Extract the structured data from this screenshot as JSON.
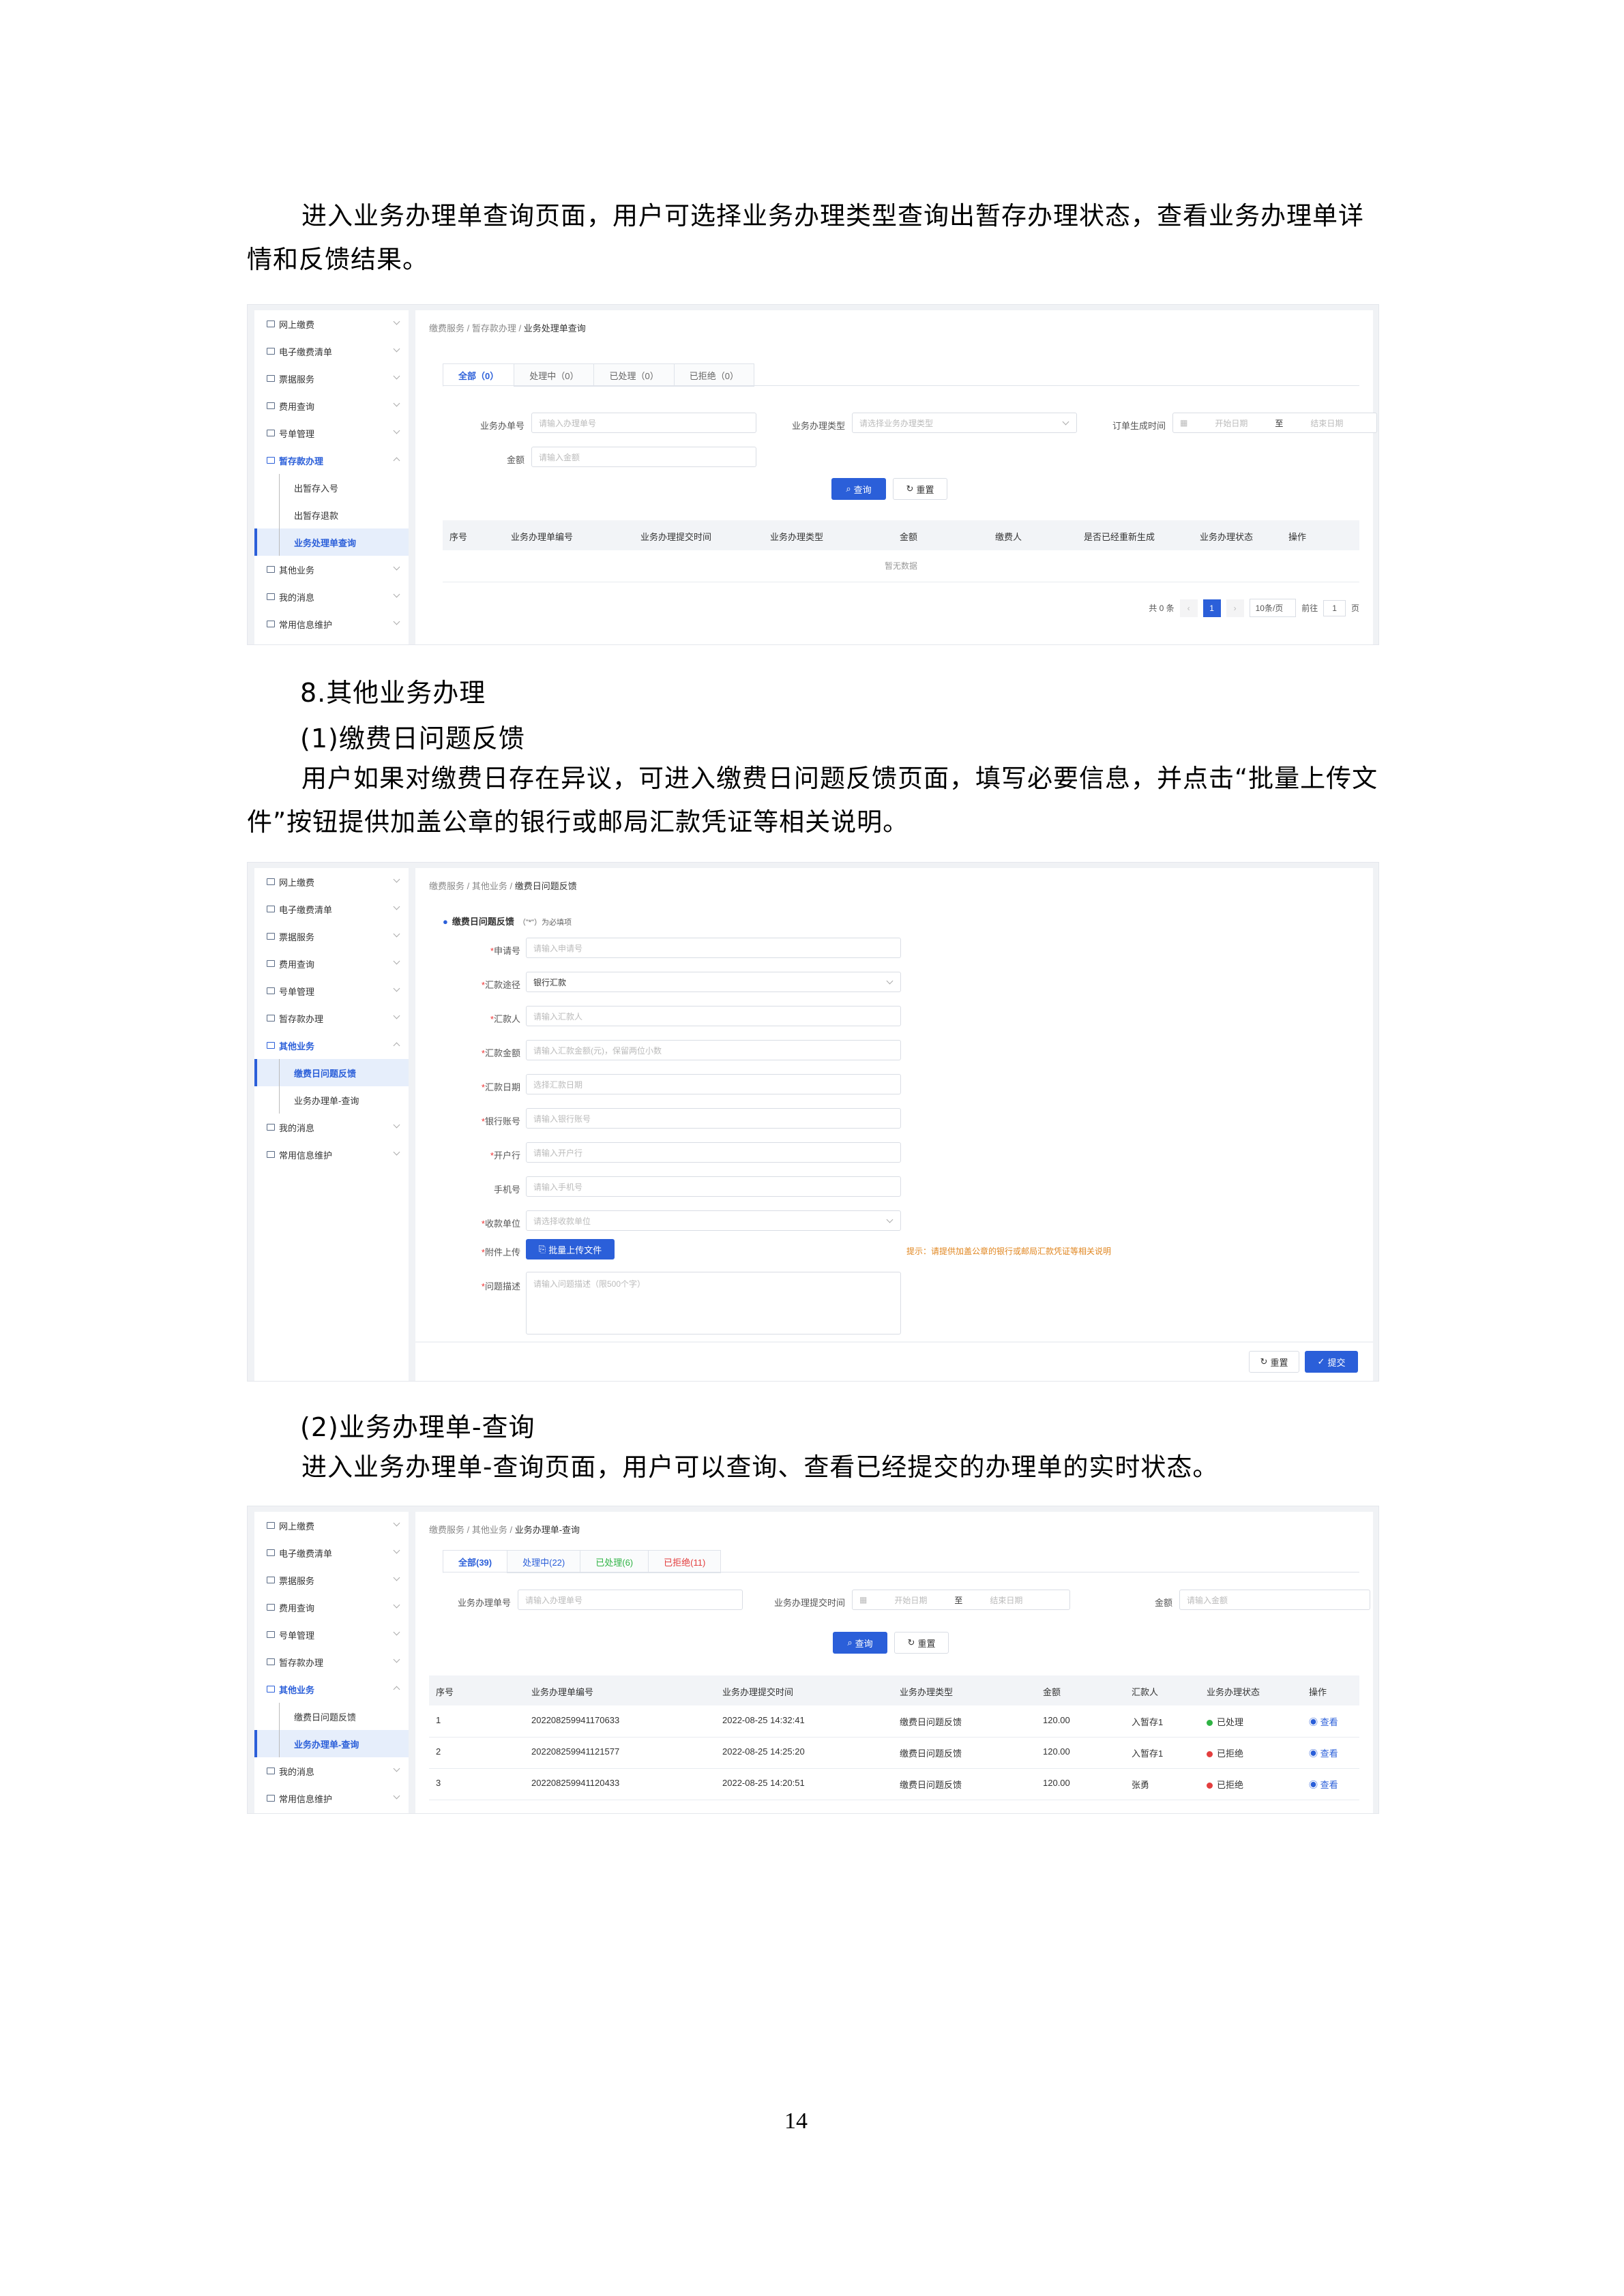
{
  "intro": {
    "para1": "进入业务办理单查询页面，用户可选择业务办理类型查询出暂存办理状态，查看业务办理单详情和反馈结果。"
  },
  "section8": {
    "title": "8.其他业务办理",
    "sub1": "(1)缴费日问题反馈",
    "para1": "用户如果对缴费日存在异议，可进入缴费日问题反馈页面，填写必要信息，并点击“批量上传文件”按钮提供加盖公章的银行或邮局汇款凭证等相关说明。",
    "sub2": "(2)业务办理单-查询",
    "para2": "进入业务办理单-查询页面，用户可以查询、查看已经提交的办理单的实时状态。"
  },
  "sidebar_common": {
    "online_pay": "网上缴费",
    "e_bill": "电子缴费清单",
    "invoice": "票据服务",
    "fee_query": "费用查询",
    "account_mgmt": "号单管理",
    "temp_pay": "暂存款办理",
    "other_biz": "其他业务",
    "my_msg": "我的消息",
    "common_info": "常用信息维护"
  },
  "shot1": {
    "breadcrumb": [
      "缴费服务",
      "暂存款办理",
      "业务处理单查询"
    ],
    "sub_items": [
      "出暂存入号",
      "出暂存退款",
      "业务处理单查询"
    ],
    "tabs": [
      "全部（0）",
      "处理中（0）",
      "已处理（0）",
      "已拒绝（0）"
    ],
    "labels": {
      "order_no": "业务办单号",
      "type": "业务办理类型",
      "gen_time": "订单生成时间",
      "amount": "金额",
      "to": "至"
    },
    "placeholders": {
      "order_no": "请输入办理单号",
      "type": "请选择业务办理类型",
      "start": "开始日期",
      "end": "结束日期",
      "amount": "请输入金额"
    },
    "buttons": {
      "query": "查询",
      "reset": "重置"
    },
    "columns": [
      "序号",
      "业务办理单编号",
      "业务办理提交时间",
      "业务办理类型",
      "金额",
      "缴费人",
      "是否已经重新生成",
      "业务办理状态",
      "操作"
    ],
    "empty": "暂无数据",
    "pager": {
      "total": "共 0 条",
      "page": "1",
      "size": "10条/页",
      "goto": "前往",
      "goto_val": "1",
      "unit": "页"
    }
  },
  "shot2": {
    "breadcrumb": [
      "缴费服务",
      "其他业务",
      "缴费日问题反馈"
    ],
    "sub_items": [
      "缴费日问题反馈",
      "业务办理单-查询"
    ],
    "section_title": "缴费日问题反馈",
    "section_note": "（\"*\"）为必填项",
    "fields": [
      {
        "label": "申请号",
        "req": "*",
        "ph": "请输入申请号",
        "select": false,
        "filled": false
      },
      {
        "label": "汇款途径",
        "req": "*",
        "ph": "银行汇款",
        "select": true,
        "filled": true
      },
      {
        "label": "汇款人",
        "req": "*",
        "ph": "请输入汇款人",
        "select": false,
        "filled": false
      },
      {
        "label": "汇款金额",
        "req": "*",
        "ph": "请输入汇款金额(元)，保留两位小数",
        "select": false,
        "filled": false
      },
      {
        "label": "汇款日期",
        "req": "*",
        "ph": "选择汇款日期",
        "select": false,
        "filled": false
      },
      {
        "label": "银行账号",
        "req": "*",
        "ph": "请输入银行账号",
        "select": false,
        "filled": false
      },
      {
        "label": "开户行",
        "req": "*",
        "ph": "请输入开户行",
        "select": false,
        "filled": false
      },
      {
        "label": "手机号",
        "req": "",
        "ph": "请输入手机号",
        "select": false,
        "filled": false
      },
      {
        "label": "收款单位",
        "req": "*",
        "ph": "请选择收款单位",
        "select": true,
        "filled": false
      }
    ],
    "upload_label": "附件上传",
    "upload_btn": "批量上传文件",
    "upload_tip": "提示：请提供加盖公章的银行或邮局汇款凭证等相关说明",
    "desc_label": "问题描述",
    "desc_ph": "请输入问题描述（限500个字）",
    "reset": "重置",
    "submit": "提交"
  },
  "shot3": {
    "breadcrumb": [
      "缴费服务",
      "其他业务",
      "业务办理单-查询"
    ],
    "sub_items": [
      "缴费日问题反馈",
      "业务办理单-查询"
    ],
    "tabs": [
      "全部(39)",
      "处理中(22)",
      "已处理(6)",
      "已拒绝(11)"
    ],
    "labels": {
      "order_no": "业务办理单号",
      "submit_time": "业务办理提交时间",
      "amount": "金额",
      "to": "至"
    },
    "placeholders": {
      "order_no": "请输入办理单号",
      "start": "开始日期",
      "end": "结束日期",
      "amount": "请输入金额"
    },
    "buttons": {
      "query": "查询",
      "reset": "重置"
    },
    "columns": [
      "序号",
      "业务办理单编号",
      "业务办理提交时间",
      "业务办理类型",
      "金额",
      "汇款人",
      "业务办理状态",
      "操作"
    ],
    "rows": [
      {
        "no": "1",
        "id": "202208259941170633",
        "time": "2022-08-25 14:32:41",
        "type": "缴费日问题反馈",
        "amount": "120.00",
        "payer": "入暂存1",
        "status": "已处理",
        "status_color": "#2fb344",
        "op": "查看"
      },
      {
        "no": "2",
        "id": "202208259941121577",
        "time": "2022-08-25 14:25:20",
        "type": "缴费日问题反馈",
        "amount": "120.00",
        "payer": "入暂存1",
        "status": "已拒绝",
        "status_color": "#e33e3e",
        "op": "查看"
      },
      {
        "no": "3",
        "id": "202208259941120433",
        "time": "2022-08-25 14:20:51",
        "type": "缴费日问题反馈",
        "amount": "120.00",
        "payer": "张勇",
        "status": "已拒绝",
        "status_color": "#e33e3e",
        "op": "查看"
      }
    ]
  },
  "page_number": "14"
}
